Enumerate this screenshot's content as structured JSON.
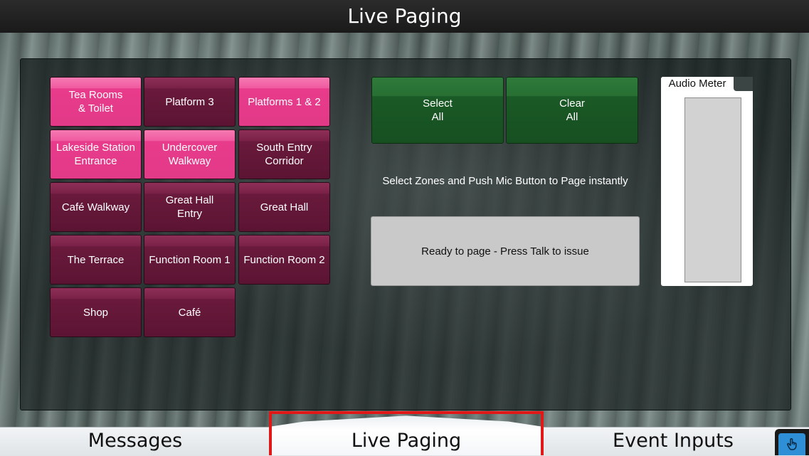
{
  "header": {
    "title": "Live Paging"
  },
  "zones": [
    {
      "label": "Tea Rooms\n& Toilet",
      "selected": true
    },
    {
      "label": "Platform 3",
      "selected": false
    },
    {
      "label": "Platforms 1 & 2",
      "selected": true
    },
    {
      "label": "Lakeside Station\nEntrance",
      "selected": true
    },
    {
      "label": "Undercover\nWalkway",
      "selected": true
    },
    {
      "label": "South Entry\nCorridor",
      "selected": false
    },
    {
      "label": "Café Walkway",
      "selected": false
    },
    {
      "label": "Great Hall\nEntry",
      "selected": false
    },
    {
      "label": "Great Hall",
      "selected": false
    },
    {
      "label": "The Terrace",
      "selected": false
    },
    {
      "label": "Function Room 1",
      "selected": false
    },
    {
      "label": "Function Room 2",
      "selected": false
    },
    {
      "label": "Shop",
      "selected": false
    },
    {
      "label": "Café",
      "selected": false
    }
  ],
  "controls": {
    "select_all": "Select\nAll",
    "clear_all": "Clear\nAll",
    "instructions": "Select Zones and Push Mic Button to Page instantly",
    "status": "Ready to page - Press Talk to issue"
  },
  "meter": {
    "label": "Audio Meter",
    "level": 0
  },
  "tabs": {
    "messages": "Messages",
    "live_paging": "Live Paging",
    "event_inputs": "Event Inputs",
    "active": "live_paging"
  },
  "colors": {
    "zone_selected": "#e23a88",
    "zone_unselected": "#6a1a3c",
    "action_green": "#1a5a26",
    "active_tab_outline": "#e01818"
  },
  "icons": {
    "corner": "hand-pointer-icon"
  }
}
